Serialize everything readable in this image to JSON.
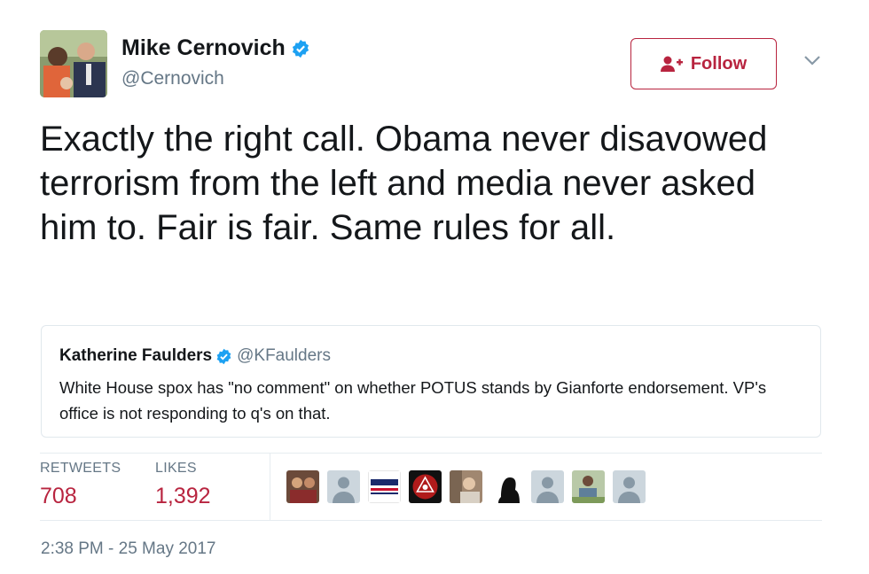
{
  "author": {
    "name": "Mike Cernovich",
    "handle": "@Cernovich",
    "verified": true
  },
  "follow_label": "Follow",
  "tweet_text": "Exactly the right call. Obama never disavowed terrorism from the left and media never asked him to. Fair is fair. Same rules for all.",
  "quoted": {
    "name": "Katherine Faulders",
    "handle": "@KFaulders",
    "verified": true,
    "text": "White House spox has \"no comment\" on whether POTUS stands by Gianforte endorsement. VP's office is not responding to q's on that."
  },
  "stats": {
    "retweets_label": "RETWEETS",
    "retweets_value": "708",
    "likes_label": "LIKES",
    "likes_value": "1,392"
  },
  "liker_avatars": [
    "photo-avatar",
    "default-avatar",
    "trump-logo-avatar",
    "emblem-avatar",
    "photo-avatar",
    "silhouette-avatar",
    "default-avatar",
    "photo-avatar",
    "default-avatar"
  ],
  "timestamp": "2:38 PM - 25 May 2017",
  "colors": {
    "accent": "#b8243f",
    "verified": "#1da1f2",
    "secondary_text": "#657786",
    "border": "#e1e8ed"
  }
}
